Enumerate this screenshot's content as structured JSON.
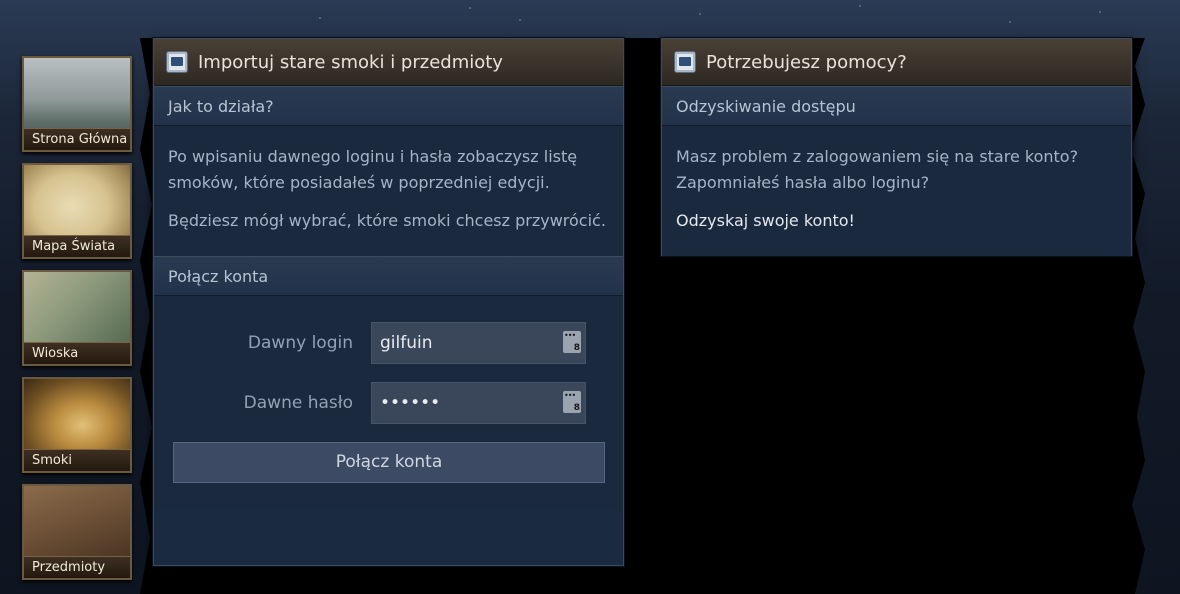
{
  "sidebar": {
    "items": [
      {
        "label": "Strona Główna",
        "icon": "forest-thumbnail"
      },
      {
        "label": "Mapa Świata",
        "icon": "world-map-thumbnail"
      },
      {
        "label": "Wioska",
        "icon": "village-thumbnail"
      },
      {
        "label": "Smoki",
        "icon": "dragon-thumbnail"
      },
      {
        "label": "Przedmioty",
        "icon": "items-thumbnail"
      }
    ]
  },
  "import_panel": {
    "title": "Importuj stare smoki i przedmioty",
    "how_header": "Jak to działa?",
    "paragraph1": "Po wpisaniu dawnego loginu i hasła zobaczysz listę smoków, które posiadałeś w poprzedniej edycji.",
    "paragraph2": "Będziesz mógł wybrać, które smoki chcesz przywrócić.",
    "connect_header": "Połącz konta",
    "login_label": "Dawny login",
    "login_value": "gilfuin",
    "password_label": "Dawne hasło",
    "password_value": "••••••",
    "submit_label": "Połącz konta"
  },
  "help_panel": {
    "title": "Potrzebujesz pomocy?",
    "recovery_header": "Odzyskiwanie dostępu",
    "text": "Masz problem z zalogowaniem się na stare konto? Zapomniałeś hasła albo loginu?",
    "link": "Odzyskaj swoje konto!"
  }
}
